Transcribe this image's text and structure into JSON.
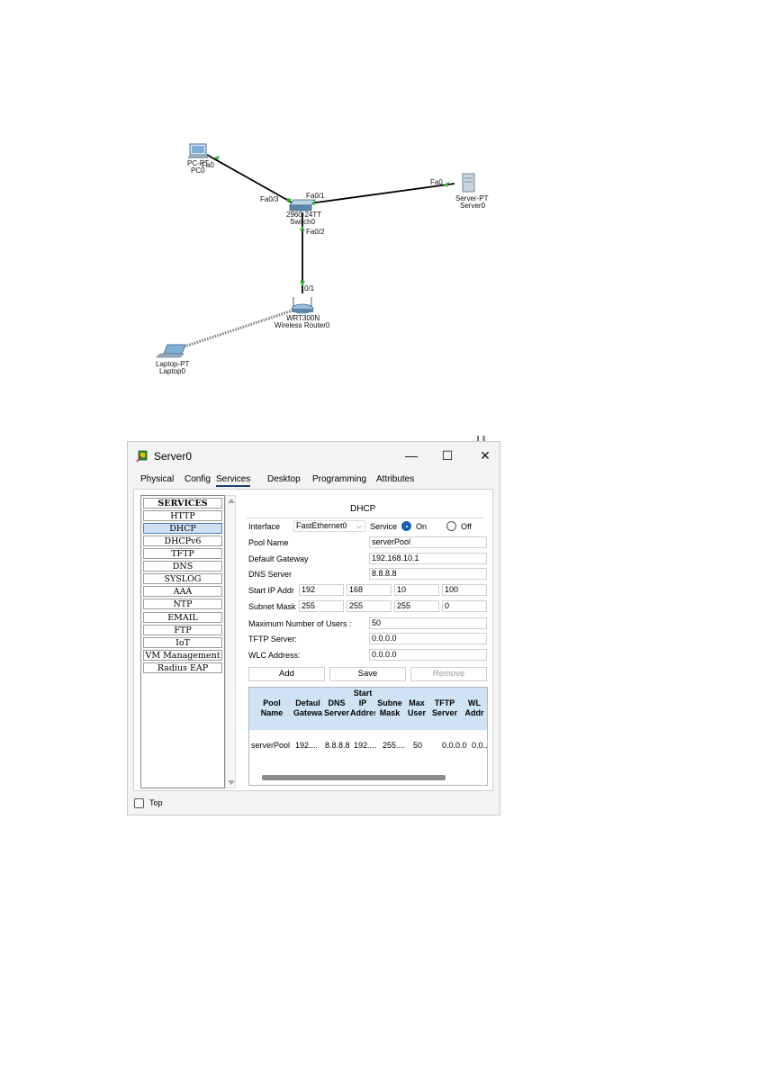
{
  "topology": {
    "nodes": {
      "pc": {
        "type_label": "PC-PT",
        "name": "PC0"
      },
      "switch": {
        "type_label": "2960-24TT",
        "name": "Switch0"
      },
      "server": {
        "type_label": "Server-PT",
        "name": "Server0"
      },
      "router": {
        "type_label": "WRT300N",
        "name": "Wireless Router0"
      },
      "laptop": {
        "type_label": "Laptop-PT",
        "name": "Laptop0"
      }
    },
    "ports": {
      "pc_fa0": "Fa0",
      "sw_fa03": "Fa0/3",
      "sw_fa01": "Fa0/1",
      "sw_fa02": "Fa0/2",
      "server_fa0": "Fa0",
      "router_port": "0/1"
    },
    "colors": {
      "link": "#000000",
      "port_up": "#2db52d",
      "wireless": "#7a7a7a"
    }
  },
  "window": {
    "title": "Server0",
    "controls": {
      "minimize": "—",
      "maximize": "☐",
      "close": "✕"
    },
    "tabs": [
      "Physical",
      "Config",
      "Services",
      "Desktop",
      "Programming",
      "Attributes"
    ],
    "active_tab": "Services",
    "services": [
      "SERVICES",
      "HTTP",
      "DHCP",
      "DHCPv6",
      "TFTP",
      "DNS",
      "SYSLOG",
      "AAA",
      "NTP",
      "EMAIL",
      "FTP",
      "IoT",
      "VM Management",
      "Radius EAP"
    ],
    "selected_service": "DHCP",
    "dhcp": {
      "title": "DHCP",
      "interface_label": "Interface",
      "interface_value": "FastEthernet0",
      "service_label": "Service",
      "on_label": "On",
      "off_label": "Off",
      "service_state": "On",
      "pool_name_label": "Pool Name",
      "pool_name": "serverPool",
      "gateway_label": "Default Gateway",
      "gateway": "192.168.10.1",
      "dns_label": "DNS Server",
      "dns": "8.8.8.8",
      "start_ip_label": "Start IP Addr",
      "start_ip": [
        "192",
        "168",
        "10",
        "100"
      ],
      "subnet_label": "Subnet Mask",
      "subnet": [
        "255",
        "255",
        "255",
        "0"
      ],
      "max_users_label": "Maximum Number of Users :",
      "max_users": "50",
      "tftp_label": "TFTP Server:",
      "tftp": "0.0.0.0",
      "wlc_label": "WLC Address:",
      "wlc": "0.0.0.0",
      "buttons": {
        "add": "Add",
        "save": "Save",
        "remove": "Remove"
      },
      "table": {
        "headers": [
          "Pool Name",
          "Default Gateway",
          "DNS Server",
          "Start IP Address",
          "Subnet Mask",
          "Max User",
          "TFTP Server",
          "WLC Address"
        ],
        "header_shown": [
          "Pool\nName",
          "Defaul\nGatewa",
          "DNS\nServer",
          "Start\nIP\nAddres",
          "Subne\nMask",
          "Max\nUser",
          "TFTP\nServer",
          "WL\nAddr"
        ],
        "rows": [
          [
            "serverPool",
            "192....",
            "8.8.8.8",
            "192....",
            "255....",
            "50",
            "0.0.0.0",
            "0.0..."
          ]
        ]
      }
    },
    "top_checkbox_label": "Top",
    "accent": "#1a5fb4"
  }
}
